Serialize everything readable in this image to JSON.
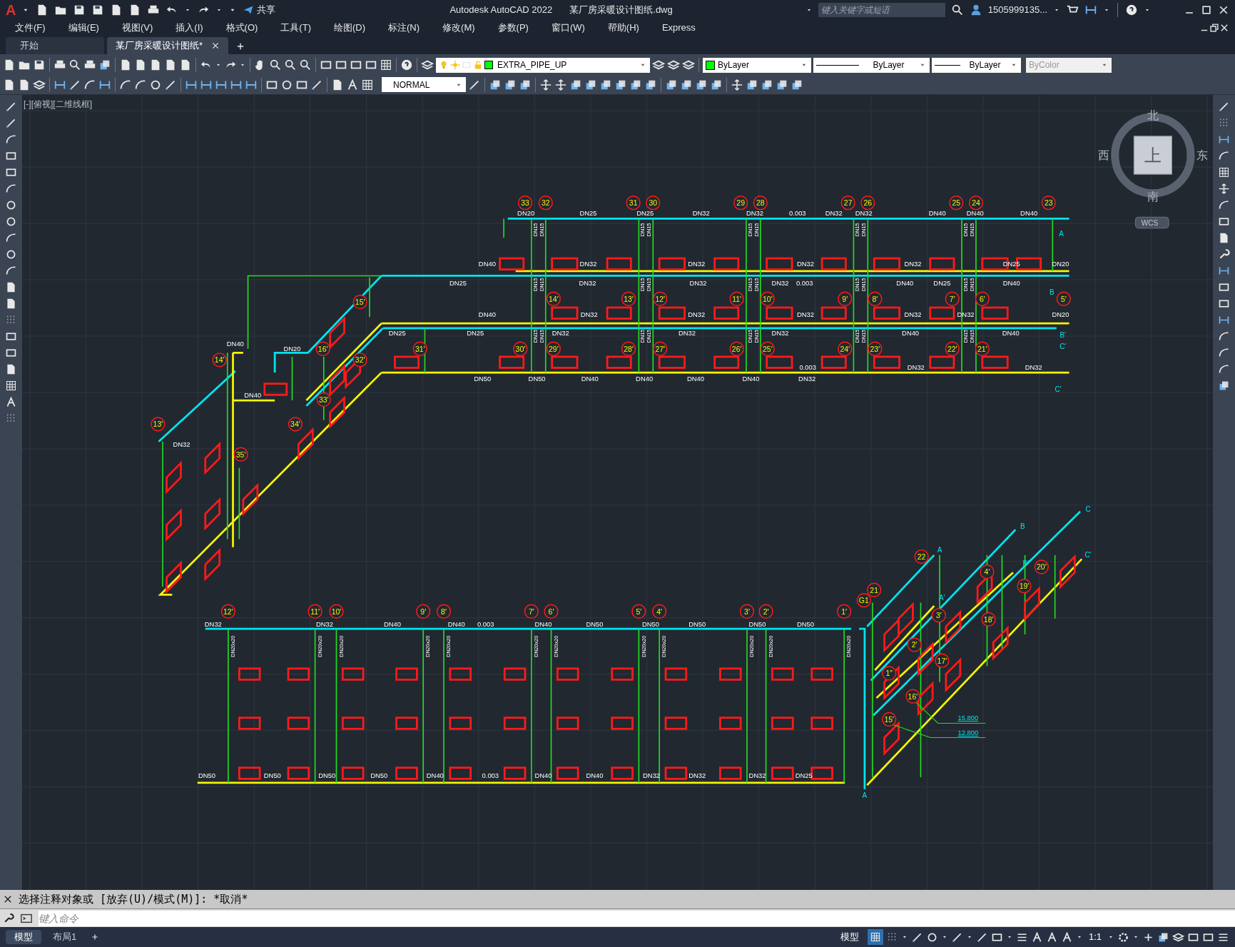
{
  "title_bar": {
    "logo_letter": "A",
    "share": "共享",
    "title": "Autodesk AutoCAD 2022",
    "file": "某厂房采暖设计图纸.dwg",
    "search_placeholder": "键入关键字或短语",
    "user": "1505999135..."
  },
  "menu": [
    "文件(F)",
    "编辑(E)",
    "视图(V)",
    "插入(I)",
    "格式(O)",
    "工具(T)",
    "绘图(D)",
    "标注(N)",
    "修改(M)",
    "参数(P)",
    "窗口(W)",
    "帮助(H)",
    "Express"
  ],
  "tabs": [
    {
      "label": "开始",
      "selected": false
    },
    {
      "label": "某厂房采暖设计图纸*",
      "selected": true
    }
  ],
  "toolbar": {
    "layer": "EXTRA_PIPE_UP",
    "color": {
      "label": "ByLayer",
      "color": "#00ff00"
    },
    "linetype": "ByLayer",
    "lineweight": "ByLayer",
    "plot_style": {
      "label": "ByColor",
      "disabled": true
    },
    "text_style": "NORMAL"
  },
  "viewport_label": "[-][俯视][二维线框]",
  "viewcube": {
    "north": "北",
    "south": "南",
    "east": "东",
    "west": "西",
    "face": "上",
    "ucs": "WCS"
  },
  "drawing": {
    "tags": [
      "33",
      "32",
      "31",
      "30",
      "29",
      "28",
      "27",
      "26",
      "25",
      "24",
      "23",
      "15′",
      "14′",
      "13′",
      "12′",
      "11′",
      "10′",
      "9′",
      "8′",
      "7′",
      "6′",
      "5′",
      "16′",
      "31′",
      "30′",
      "29′",
      "28′",
      "27′",
      "26′",
      "25′",
      "24′",
      "23′",
      "22′",
      "21′",
      "14′",
      "32′",
      "33′",
      "13′",
      "34′",
      "35′",
      "22",
      "20′",
      "4′",
      "19′",
      "21",
      "G1",
      "12′",
      "11′",
      "10′",
      "9′",
      "8′",
      "7′",
      "6′",
      "5′",
      "4′",
      "3′",
      "2′",
      "1′",
      "3′",
      "18′",
      "2′",
      "17′",
      "1″",
      "16′",
      "15′"
    ],
    "pipe_labels": [
      "DN20",
      "DN25",
      "DN25",
      "DN32",
      "DN32",
      "0.003",
      "DN32",
      "DN32",
      "DN40",
      "DN40",
      "DN40",
      "DN40",
      "DN32",
      "DN32",
      "DN32",
      "DN32",
      "DN25",
      "DN20",
      "DN25",
      "DN32",
      "DN32",
      "DN32",
      "0.003",
      "DN40",
      "DN25",
      "DN40",
      "DN40",
      "DN32",
      "DN32",
      "DN32",
      "DN32",
      "DN32",
      "DN20",
      "DN25",
      "DN25",
      "DN32",
      "DN32",
      "DN32",
      "DN40",
      "DN40",
      "0.003",
      "DN32",
      "DN32",
      "DN50",
      "DN50",
      "DN40",
      "DN40",
      "DN40",
      "DN40",
      "DN32",
      "DN40",
      "DN20",
      "DN40",
      "DN32",
      "DN32",
      "DN32",
      "DN40",
      "DN40",
      "0.003",
      "DN40",
      "DN50",
      "DN50",
      "DN50",
      "DN50",
      "DN50",
      "DN50",
      "DN50",
      "DN50",
      "DN50",
      "DN40",
      "0.003",
      "DN40",
      "DN40",
      "DN32",
      "DN32",
      "DN32",
      "DN25"
    ],
    "riser_labels": [
      "DN15",
      "DN15",
      "DN15",
      "DN15",
      "DN15",
      "DN15",
      "DN15",
      "DN15",
      "DN15",
      "DN15",
      "DN15",
      "DN15",
      "DN15",
      "DN15",
      "DN15",
      "DN15",
      "DN15",
      "DN15",
      "DN15",
      "DN15",
      "DN15",
      "DN15",
      "DN15",
      "DN15",
      "DN15",
      "DN15",
      "DN15",
      "DN15",
      "DN15",
      "DN15",
      "DN20x20",
      "DN20x20",
      "DN20x20",
      "DN20x20",
      "DN20x20",
      "DN20x20",
      "DN20x20",
      "DN20x20",
      "DN20x20",
      "DN20x20",
      "DN20x20",
      "DN20x20"
    ],
    "elevations": [
      "15.800",
      "12.800"
    ],
    "axis_letters": [
      "A",
      "B",
      "B′",
      "C′",
      "C′",
      "A",
      "B",
      "C",
      "A′",
      "B′",
      "C′",
      "A"
    ]
  },
  "command_line": {
    "history": "选择注释对象或 [放弃(U)/模式(M)]: *取消*",
    "placeholder": "键入命令"
  },
  "layout_tabs": [
    {
      "label": "模型",
      "selected": true
    },
    {
      "label": "布局1",
      "selected": false
    }
  ],
  "status_bar": {
    "space": "模型",
    "scale": "1:1",
    "grid_on": true
  }
}
